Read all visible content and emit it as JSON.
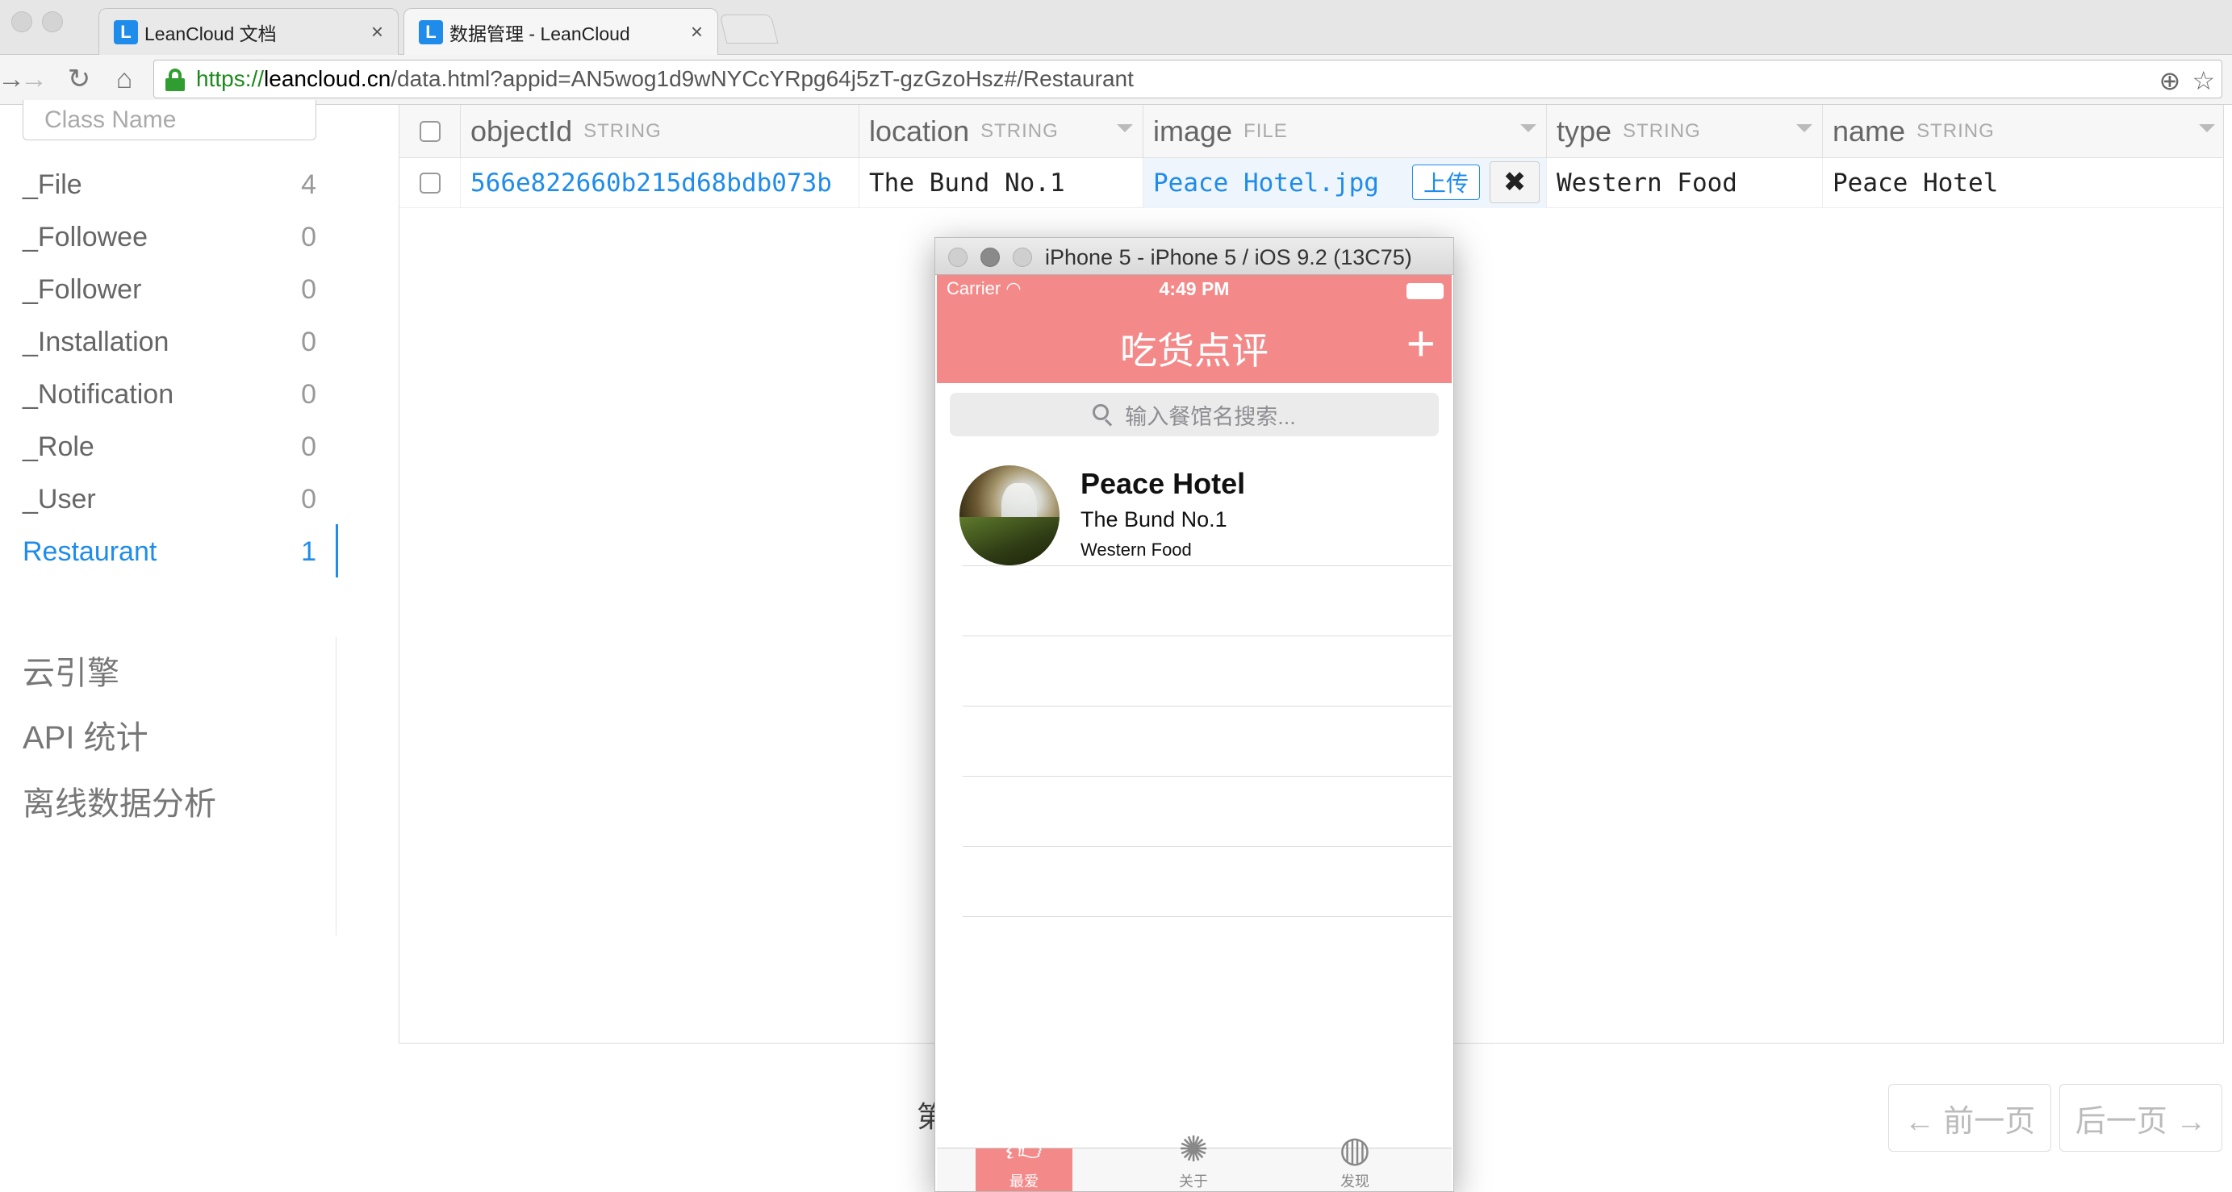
{
  "browser": {
    "tabs": [
      {
        "title": "LeanCloud 文档",
        "favicon": "L",
        "active": false
      },
      {
        "title": "数据管理 - LeanCloud",
        "favicon": "L",
        "active": true
      }
    ],
    "url": {
      "scheme": "https://",
      "host": "leancloud.cn",
      "path": "/data.html?appid=AN5wog1d9wNYCcYRpg64j5zT-gzGzoHsz#/Restaurant"
    }
  },
  "sidebar": {
    "search_placeholder": "Class Name",
    "classes": [
      {
        "name": "_File",
        "count": "4"
      },
      {
        "name": "_Followee",
        "count": "0"
      },
      {
        "name": "_Follower",
        "count": "0"
      },
      {
        "name": "_Installation",
        "count": "0"
      },
      {
        "name": "_Notification",
        "count": "0"
      },
      {
        "name": "_Role",
        "count": "0"
      },
      {
        "name": "_User",
        "count": "0"
      },
      {
        "name": "Restaurant",
        "count": "1"
      }
    ],
    "active_class": "Restaurant",
    "nav_links": [
      "云引擎",
      "API 统计",
      "离线数据分析"
    ]
  },
  "table": {
    "columns": [
      {
        "name": "objectId",
        "type": "STRING"
      },
      {
        "name": "location",
        "type": "STRING"
      },
      {
        "name": "image",
        "type": "FILE"
      },
      {
        "name": "type",
        "type": "STRING"
      },
      {
        "name": "name",
        "type": "STRING"
      }
    ],
    "rows": [
      {
        "objectId": "566e822660b215d68bdb073b",
        "location": "The Bund No.1",
        "image": "Peace Hotel.jpg",
        "type": "Western Food",
        "name": "Peace Hotel"
      }
    ],
    "upload_label": "上传",
    "delete_label": "✖"
  },
  "pagination": {
    "page_label": "第",
    "prev_label": "← 前一页",
    "next_label": "后一页 →"
  },
  "simulator": {
    "window_title": "iPhone 5 - iPhone 5 / iOS 9.2 (13C75)",
    "status": {
      "carrier": "Carrier",
      "time": "4:49 PM"
    },
    "nav_title": "吃货点评",
    "add_label": "+",
    "search_placeholder": "输入餐馆名搜索...",
    "cell": {
      "title": "Peace Hotel",
      "location": "The Bund No.1",
      "type": "Western Food"
    },
    "tabs": [
      {
        "label": "最爱",
        "icon": "thumbs-up-icon",
        "active": true
      },
      {
        "label": "关于",
        "icon": "hub-icon",
        "active": false
      },
      {
        "label": "发现",
        "icon": "ball-icon",
        "active": false
      }
    ]
  },
  "colors": {
    "accent_blue": "#1f8ceb",
    "app_pink": "#f38a89",
    "secure_green": "#2f9d2f"
  }
}
